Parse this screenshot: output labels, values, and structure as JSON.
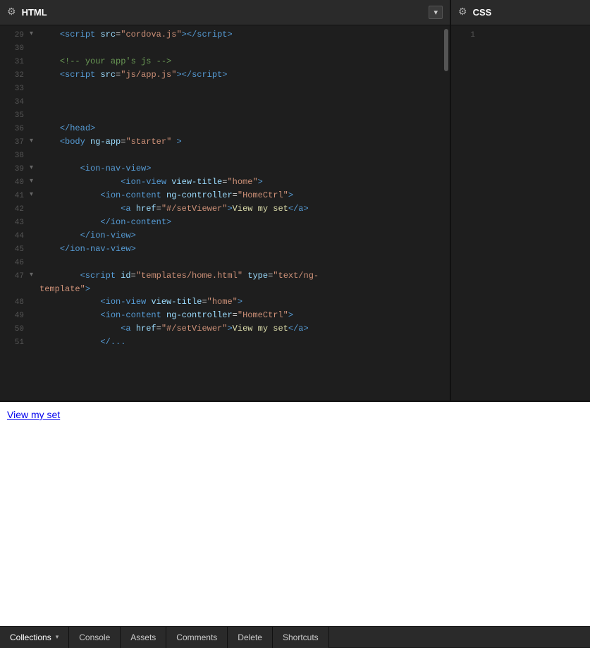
{
  "html_panel": {
    "title": "HTML",
    "dropdown_label": "▾"
  },
  "css_panel": {
    "title": "CSS"
  },
  "code_lines": [
    {
      "num": "29",
      "arrow": "",
      "indent": "    ",
      "content": "<script src=\"cordova.js\"><\\/script>"
    },
    {
      "num": "30",
      "arrow": "",
      "indent": "",
      "content": ""
    },
    {
      "num": "31",
      "arrow": "",
      "indent": "    ",
      "content": "<!-- your app's js -->"
    },
    {
      "num": "32",
      "arrow": "",
      "indent": "    ",
      "content": "<script src=\"js/app.js\"><\\/script>"
    },
    {
      "num": "33",
      "arrow": "",
      "indent": "",
      "content": ""
    },
    {
      "num": "34",
      "arrow": "",
      "indent": "",
      "content": ""
    },
    {
      "num": "35",
      "arrow": "",
      "indent": "",
      "content": ""
    },
    {
      "num": "36",
      "arrow": "",
      "indent": "    ",
      "content": "</head>"
    },
    {
      "num": "37",
      "arrow": "▾",
      "indent": "    ",
      "content": "<body ng-app=\"starter\" >"
    },
    {
      "num": "38",
      "arrow": "",
      "indent": "",
      "content": ""
    },
    {
      "num": "39",
      "arrow": "▾",
      "indent": "        ",
      "content": "<ion-nav-view>"
    },
    {
      "num": "40",
      "arrow": "▾",
      "indent": "                ",
      "content": "<ion-view view-title=\"home\">"
    },
    {
      "num": "41",
      "arrow": "▾",
      "indent": "            ",
      "content": "<ion-content ng-controller=\"HomeCtrl\">"
    },
    {
      "num": "42",
      "arrow": "",
      "indent": "                ",
      "content": "<a href=\"#/setViewer\">View my set</a>"
    },
    {
      "num": "43",
      "arrow": "",
      "indent": "            ",
      "content": "</ion-content>"
    },
    {
      "num": "44",
      "arrow": "",
      "indent": "        ",
      "content": "</ion-view>"
    },
    {
      "num": "45",
      "arrow": "",
      "indent": "    ",
      "content": "</ion-nav-view>"
    },
    {
      "num": "46",
      "arrow": "",
      "indent": "",
      "content": ""
    },
    {
      "num": "47",
      "arrow": "▾",
      "indent": "        ",
      "content": "<script id=\"templates/home.html\" type=\"text/ng-template\">"
    },
    {
      "num": "48",
      "arrow": "",
      "indent": "            ",
      "content": "<ion-view view-title=\"home\">"
    },
    {
      "num": "49",
      "arrow": "",
      "indent": "            ",
      "content": "<ion-content ng-controller=\"HomeCtrl\">"
    },
    {
      "num": "50",
      "arrow": "",
      "indent": "                ",
      "content": "<a href=\"#/setViewer\">View my set</a>"
    },
    {
      "num": "51",
      "arrow": "",
      "indent": "            ",
      "content": "</..."
    }
  ],
  "css_line_num": "1",
  "preview": {
    "link_text": "View my set",
    "link_href": "#/setViewer"
  },
  "bottom_bar": {
    "collections_label": "Collections",
    "console_label": "Console",
    "assets_label": "Assets",
    "comments_label": "Comments",
    "delete_label": "Delete",
    "shortcuts_label": "Shortcuts"
  }
}
